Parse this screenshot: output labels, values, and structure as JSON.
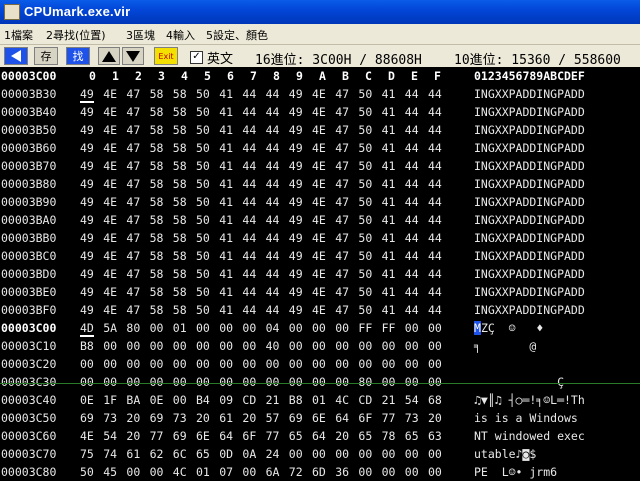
{
  "window": {
    "title": "CPUmark.exe.vir"
  },
  "menu": [
    "1檔案",
    "2尋找(位置)",
    "3區塊",
    "4輸入",
    "5設定、顏色"
  ],
  "toolbar": {
    "save_label": "存",
    "find_label": "找",
    "exit_label": "Exit",
    "checkbox_mark": "✓",
    "checkbox_checked": true,
    "chinese_label": "英文",
    "hex_position": "16進位: 3C00H / 88608H",
    "dec_position": "10進位: 15360 / 558600"
  },
  "header": {
    "addr": "00003C00",
    "cols": [
      "0",
      "1",
      "2",
      "3",
      "4",
      "5",
      "6",
      "7",
      "8",
      "9",
      "A",
      "B",
      "C",
      "D",
      "E",
      "F"
    ],
    "ascii": "0123456789ABCDEF"
  },
  "rows": [
    {
      "addr": "00003B30",
      "bytes": [
        "49",
        "4E",
        "47",
        "58",
        "58",
        "50",
        "41",
        "44",
        "44",
        "49",
        "4E",
        "47",
        "50",
        "41",
        "44",
        "44"
      ],
      "ascii": "INGXXPADDINGPADD"
    },
    {
      "addr": "00003B40",
      "bytes": [
        "49",
        "4E",
        "47",
        "58",
        "58",
        "50",
        "41",
        "44",
        "44",
        "49",
        "4E",
        "47",
        "50",
        "41",
        "44",
        "44"
      ],
      "ascii": "INGXXPADDINGPADD"
    },
    {
      "addr": "00003B50",
      "bytes": [
        "49",
        "4E",
        "47",
        "58",
        "58",
        "50",
        "41",
        "44",
        "44",
        "49",
        "4E",
        "47",
        "50",
        "41",
        "44",
        "44"
      ],
      "ascii": "INGXXPADDINGPADD"
    },
    {
      "addr": "00003B60",
      "bytes": [
        "49",
        "4E",
        "47",
        "58",
        "58",
        "50",
        "41",
        "44",
        "44",
        "49",
        "4E",
        "47",
        "50",
        "41",
        "44",
        "44"
      ],
      "ascii": "INGXXPADDINGPADD"
    },
    {
      "addr": "00003B70",
      "bytes": [
        "49",
        "4E",
        "47",
        "58",
        "58",
        "50",
        "41",
        "44",
        "44",
        "49",
        "4E",
        "47",
        "50",
        "41",
        "44",
        "44"
      ],
      "ascii": "INGXXPADDINGPADD"
    },
    {
      "addr": "00003B80",
      "bytes": [
        "49",
        "4E",
        "47",
        "58",
        "58",
        "50",
        "41",
        "44",
        "44",
        "49",
        "4E",
        "47",
        "50",
        "41",
        "44",
        "44"
      ],
      "ascii": "INGXXPADDINGPADD"
    },
    {
      "addr": "00003B90",
      "bytes": [
        "49",
        "4E",
        "47",
        "58",
        "58",
        "50",
        "41",
        "44",
        "44",
        "49",
        "4E",
        "47",
        "50",
        "41",
        "44",
        "44"
      ],
      "ascii": "INGXXPADDINGPADD"
    },
    {
      "addr": "00003BA0",
      "bytes": [
        "49",
        "4E",
        "47",
        "58",
        "58",
        "50",
        "41",
        "44",
        "44",
        "49",
        "4E",
        "47",
        "50",
        "41",
        "44",
        "44"
      ],
      "ascii": "INGXXPADDINGPADD"
    },
    {
      "addr": "00003BB0",
      "bytes": [
        "49",
        "4E",
        "47",
        "58",
        "58",
        "50",
        "41",
        "44",
        "44",
        "49",
        "4E",
        "47",
        "50",
        "41",
        "44",
        "44"
      ],
      "ascii": "INGXXPADDINGPADD"
    },
    {
      "addr": "00003BC0",
      "bytes": [
        "49",
        "4E",
        "47",
        "58",
        "58",
        "50",
        "41",
        "44",
        "44",
        "49",
        "4E",
        "47",
        "50",
        "41",
        "44",
        "44"
      ],
      "ascii": "INGXXPADDINGPADD"
    },
    {
      "addr": "00003BD0",
      "bytes": [
        "49",
        "4E",
        "47",
        "58",
        "58",
        "50",
        "41",
        "44",
        "44",
        "49",
        "4E",
        "47",
        "50",
        "41",
        "44",
        "44"
      ],
      "ascii": "INGXXPADDINGPADD"
    },
    {
      "addr": "00003BE0",
      "bytes": [
        "49",
        "4E",
        "47",
        "58",
        "58",
        "50",
        "41",
        "44",
        "44",
        "49",
        "4E",
        "47",
        "50",
        "41",
        "44",
        "44"
      ],
      "ascii": "INGXXPADDINGPADD"
    },
    {
      "addr": "00003BF0",
      "bytes": [
        "49",
        "4E",
        "47",
        "58",
        "58",
        "50",
        "41",
        "44",
        "44",
        "49",
        "4E",
        "47",
        "50",
        "41",
        "44",
        "44"
      ],
      "ascii": "INGXXPADDINGPADD"
    },
    {
      "addr": "00003C00",
      "bytes": [
        "4D",
        "5A",
        "80",
        "00",
        "01",
        "00",
        "00",
        "00",
        "04",
        "00",
        "00",
        "00",
        "FF",
        "FF",
        "00",
        "00"
      ],
      "ascii": "MZÇ  ☺   ♦      "
    },
    {
      "addr": "00003C10",
      "bytes": [
        "B8",
        "00",
        "00",
        "00",
        "00",
        "00",
        "00",
        "00",
        "40",
        "00",
        "00",
        "00",
        "00",
        "00",
        "00",
        "00"
      ],
      "ascii": "╕       @       "
    },
    {
      "addr": "00003C20",
      "bytes": [
        "00",
        "00",
        "00",
        "00",
        "00",
        "00",
        "00",
        "00",
        "00",
        "00",
        "00",
        "00",
        "00",
        "00",
        "00",
        "00"
      ],
      "ascii": ""
    },
    {
      "addr": "00003C30",
      "bytes": [
        "00",
        "00",
        "00",
        "00",
        "00",
        "00",
        "00",
        "00",
        "00",
        "00",
        "00",
        "00",
        "80",
        "00",
        "00",
        "00"
      ],
      "ascii": "            Ç   "
    },
    {
      "addr": "00003C40",
      "bytes": [
        "0E",
        "1F",
        "BA",
        "0E",
        "00",
        "B4",
        "09",
        "CD",
        "21",
        "B8",
        "01",
        "4C",
        "CD",
        "21",
        "54",
        "68"
      ],
      "ascii": "♫▼║♫ ┤○═!╕☺L═!Th"
    },
    {
      "addr": "00003C50",
      "bytes": [
        "69",
        "73",
        "20",
        "69",
        "73",
        "20",
        "61",
        "20",
        "57",
        "69",
        "6E",
        "64",
        "6F",
        "77",
        "73",
        "20"
      ],
      "ascii": "is is a Windows "
    },
    {
      "addr": "00003C60",
      "bytes": [
        "4E",
        "54",
        "20",
        "77",
        "69",
        "6E",
        "64",
        "6F",
        "77",
        "65",
        "64",
        "20",
        "65",
        "78",
        "65",
        "63"
      ],
      "ascii": "NT windowed exec"
    },
    {
      "addr": "00003C70",
      "bytes": [
        "75",
        "74",
        "61",
        "62",
        "6C",
        "65",
        "0D",
        "0A",
        "24",
        "00",
        "00",
        "00",
        "00",
        "00",
        "00",
        "00"
      ],
      "ascii": "utable♪◙$       "
    },
    {
      "addr": "00003C80",
      "bytes": [
        "50",
        "45",
        "00",
        "00",
        "4C",
        "01",
        "07",
        "00",
        "6A",
        "72",
        "6D",
        "36",
        "00",
        "00",
        "00",
        "00"
      ],
      "ascii": "PE  L☺• jrm6    "
    }
  ],
  "colors": {
    "titlebar": "#0346d8",
    "menubar": "#ece9d8",
    "background": "#000000",
    "text": "#e8e8e8",
    "accent": "#1f52e8",
    "separator": "#2a7a2a"
  }
}
